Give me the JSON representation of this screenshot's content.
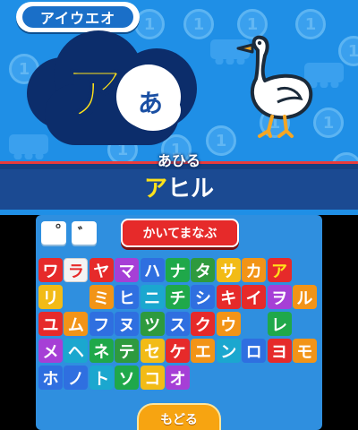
{
  "top": {
    "title_tab": "アイウエオ",
    "kana_big": "ア",
    "kana_small": "あ",
    "word_hiragana": "あひる",
    "word_katakana_first": "ア",
    "word_katakana_rest": "ヒル",
    "bg_coin_symbol": "1"
  },
  "bottom": {
    "mark_handakuten": "°",
    "mark_dakuten": "゛",
    "write_button": "かいてまなぶ",
    "back_button": "もどる",
    "grid": [
      [
        {
          "k": "ワ",
          "c": "#e62a2a",
          "t": "#ffffff"
        },
        {
          "k": "ラ",
          "c": "#f4f4f4",
          "t": "#e62a2a"
        },
        {
          "k": "ヤ",
          "c": "#e62a2a",
          "t": "#ffffff"
        },
        {
          "k": "マ",
          "c": "#a63fd6",
          "t": "#ffffff"
        },
        {
          "k": "ハ",
          "c": "#2f6fe0",
          "t": "#ffffff"
        },
        {
          "k": "ナ",
          "c": "#1fa84a",
          "t": "#ffffff"
        },
        {
          "k": "タ",
          "c": "#2e9a3e",
          "t": "#ffffff"
        },
        {
          "k": "サ",
          "c": "#f2bb16",
          "t": "#ffffff"
        },
        {
          "k": "カ",
          "c": "#f29417",
          "t": "#ffffff"
        },
        {
          "k": "ア",
          "c": "#e62a2a",
          "t": "#ffe21a"
        }
      ],
      [
        {
          "k": "",
          "c": "",
          "t": ""
        },
        {
          "k": "リ",
          "c": "#f2bb16",
          "t": "#ffffff"
        },
        {
          "k": "",
          "c": "",
          "t": ""
        },
        {
          "k": "ミ",
          "c": "#f29417",
          "t": "#ffffff"
        },
        {
          "k": "ヒ",
          "c": "#2f6fe0",
          "t": "#ffffff"
        },
        {
          "k": "ニ",
          "c": "#1ba7cf",
          "t": "#ffffff"
        },
        {
          "k": "チ",
          "c": "#1fa84a",
          "t": "#ffffff"
        },
        {
          "k": "シ",
          "c": "#2f6fe0",
          "t": "#ffffff"
        },
        {
          "k": "キ",
          "c": "#e62a2a",
          "t": "#ffffff"
        },
        {
          "k": "イ",
          "c": "#e62a2a",
          "t": "#ffffff"
        }
      ],
      [
        {
          "k": "ヲ",
          "c": "#a63fd6",
          "t": "#ffffff"
        },
        {
          "k": "ル",
          "c": "#f29417",
          "t": "#ffffff"
        },
        {
          "k": "ユ",
          "c": "#e62a2a",
          "t": "#ffffff"
        },
        {
          "k": "ム",
          "c": "#f29417",
          "t": "#ffffff"
        },
        {
          "k": "フ",
          "c": "#2f6fe0",
          "t": "#ffffff"
        },
        {
          "k": "ヌ",
          "c": "#2f6fe0",
          "t": "#ffffff"
        },
        {
          "k": "ツ",
          "c": "#2e9a3e",
          "t": "#ffffff"
        },
        {
          "k": "ス",
          "c": "#2f6fe0",
          "t": "#ffffff"
        },
        {
          "k": "ク",
          "c": "#e62a2a",
          "t": "#ffffff"
        },
        {
          "k": "ウ",
          "c": "#f29417",
          "t": "#ffffff"
        }
      ],
      [
        {
          "k": "",
          "c": "",
          "t": ""
        },
        {
          "k": "レ",
          "c": "#1fa84a",
          "t": "#ffffff"
        },
        {
          "k": "",
          "c": "",
          "t": ""
        },
        {
          "k": "メ",
          "c": "#a63fd6",
          "t": "#ffffff"
        },
        {
          "k": "ヘ",
          "c": "#1ba7cf",
          "t": "#ffffff"
        },
        {
          "k": "ネ",
          "c": "#1fa84a",
          "t": "#ffffff"
        },
        {
          "k": "テ",
          "c": "#2e9a3e",
          "t": "#ffffff"
        },
        {
          "k": "セ",
          "c": "#f2bb16",
          "t": "#ffffff"
        },
        {
          "k": "ケ",
          "c": "#e62a2a",
          "t": "#ffffff"
        },
        {
          "k": "エ",
          "c": "#f29417",
          "t": "#ffffff"
        }
      ],
      [
        {
          "k": "ン",
          "c": "#1ba7cf",
          "t": "#ffffff"
        },
        {
          "k": "ロ",
          "c": "#2f6fe0",
          "t": "#ffffff"
        },
        {
          "k": "ヨ",
          "c": "#e62a2a",
          "t": "#ffffff"
        },
        {
          "k": "モ",
          "c": "#f29417",
          "t": "#ffffff"
        },
        {
          "k": "ホ",
          "c": "#2f6fe0",
          "t": "#ffffff"
        },
        {
          "k": "ノ",
          "c": "#2f6fe0",
          "t": "#ffffff"
        },
        {
          "k": "ト",
          "c": "#1ba7cf",
          "t": "#ffffff"
        },
        {
          "k": "ソ",
          "c": "#1fa84a",
          "t": "#ffffff"
        },
        {
          "k": "コ",
          "c": "#f2bb16",
          "t": "#ffffff"
        },
        {
          "k": "オ",
          "c": "#a63fd6",
          "t": "#ffffff"
        }
      ]
    ]
  }
}
